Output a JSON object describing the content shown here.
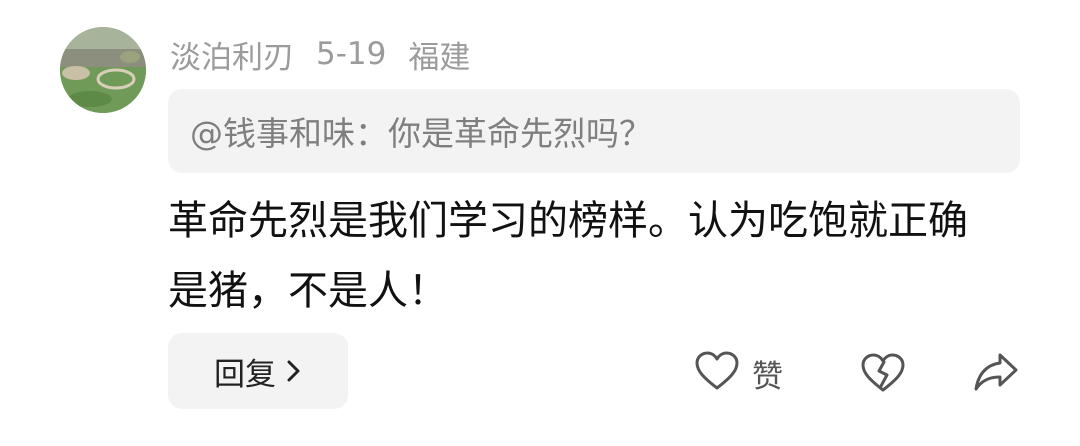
{
  "comment": {
    "username": "淡泊利刃",
    "date": "5-19",
    "location": "福建",
    "quote": "@钱事和味：你是革命先烈吗？",
    "body": "革命先烈是我们学习的榜样。认为吃饱就正确是猪，不是人！"
  },
  "actions": {
    "reply_label": "回复",
    "like_label": "赞"
  },
  "icons": {
    "reply_chevron": "chevron-right-icon",
    "like": "heart-outline-icon",
    "dislike": "broken-heart-icon",
    "share": "share-arrow-icon"
  },
  "colors": {
    "meta_text": "#9b9b9b",
    "quote_bg": "#f3f3f3",
    "body_text": "#111111"
  }
}
